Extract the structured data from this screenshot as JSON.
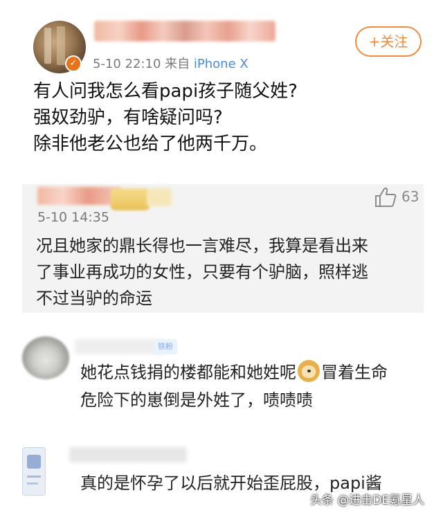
{
  "post": {
    "meta_prefix": "5-10 22:10  来自",
    "meta_source": "iPhone X",
    "follow_label": "+关注",
    "text_lines": [
      "有人问我怎么看papi孩子随父姓?",
      "强奴劲驴，有啥疑问吗?",
      "除非他老公也给了他两千万。"
    ]
  },
  "highlighted_reply": {
    "like_count": "63",
    "time": "5-10 14:35",
    "text_lines": [
      "况且她家的鼎长得也一言难尽，我算是看出来",
      "了事业再成功的女性，只要有个驴脑，照样逃",
      "不过当驴的命运"
    ],
    "icon": "thumbs-up-icon"
  },
  "reply2": {
    "tag": "铁粉",
    "line1_before": "她花点钱捐的楼都能和她姓呢",
    "line1_after": "冒着生命",
    "line2": "危险下的崽倒是外姓了，啧啧啧",
    "emoji": "doge-emoji"
  },
  "reply3": {
    "text": "真的是怀孕了以后就开始歪屁股，papi酱"
  },
  "watermark": "头条 @进击DE氪星人",
  "colors": {
    "accent_orange": "#f08a3c",
    "source_blue": "#4a8be0",
    "highlight_bg": "#f3f3f3"
  }
}
